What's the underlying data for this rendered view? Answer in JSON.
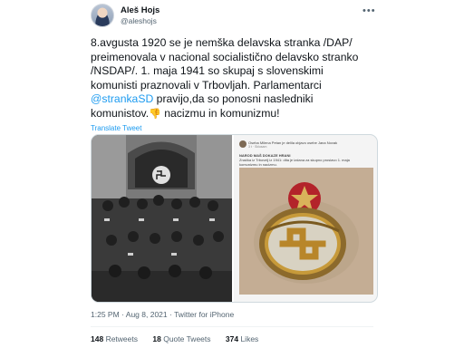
{
  "author": {
    "name": "Aleš Hojs",
    "handle": "@aleshojs",
    "more_icon": "more-dots-icon"
  },
  "tweet": {
    "lines": [
      "8.avgusta 1920 se je nemška delavska stranka /DAP/",
      "preimenovala v nacional socialistično delavsko stranko",
      "/NSDAP/. 1. maja 1941 so skupaj s slovenskimi",
      "komunisti praznovali v Trbovljah. Parlamentarci"
    ],
    "mention": "@strankaSD",
    "line5_rest": " pravijo,da so ponosni nasledniki",
    "line6_text": "komunistov.",
    "line6_emoji": "👎",
    "line6_rest": " nacizmu in komunizmu!",
    "translate_label": "Translate Tweet"
  },
  "media": {
    "embedded_post": {
      "author_line": "Oseba Milena Petan je delila objavo osebe Jana Novak",
      "sub_line": "3 t · Sklusam",
      "headline": "NAROD MAŠ DOKAZE HRANI",
      "body_line1": "Značka iz Trbovelj iz 1941: dita je izdana za skupno prosiavo 1. maja",
      "body_line2": "komunizmu in nacizmu."
    }
  },
  "meta": {
    "time": "1:25 PM",
    "date": "Aug 8, 2021",
    "source": "Twitter for iPhone",
    "separator": "·"
  },
  "stats": {
    "retweets": "148",
    "retweets_label": "Retweets",
    "quotes": "18",
    "quotes_label": "Quote Tweets",
    "likes": "374",
    "likes_label": "Likes"
  }
}
